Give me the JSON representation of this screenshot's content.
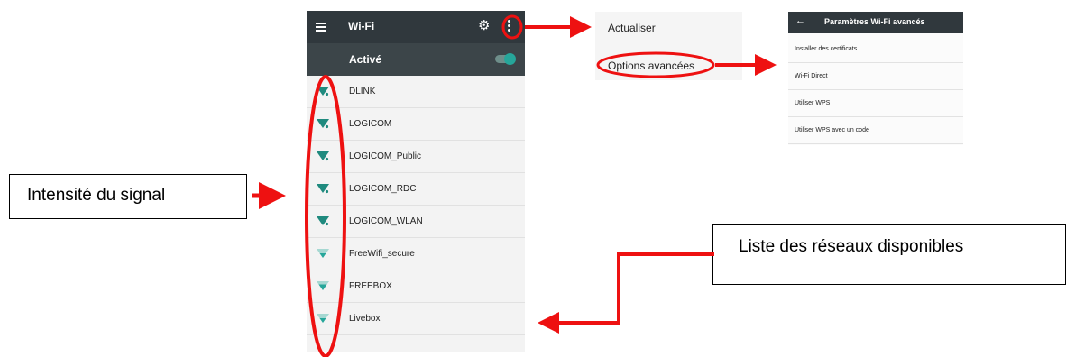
{
  "wifi_screen": {
    "title": "Wi-Fi",
    "status_label": "Activé",
    "icons": [
      "menu-icon",
      "gear-icon",
      "more-vert-icon",
      "wifi-signal-icon"
    ],
    "toggle_on": true,
    "networks": [
      {
        "name": "DLINK",
        "signal": 4
      },
      {
        "name": "LOGICOM",
        "signal": 4
      },
      {
        "name": "LOGICOM_Public",
        "signal": 4
      },
      {
        "name": "LOGICOM_RDC",
        "signal": 4
      },
      {
        "name": "LOGICOM_WLAN",
        "signal": 4
      },
      {
        "name": "FreeWifi_secure",
        "signal": 2
      },
      {
        "name": "FREEBOX",
        "signal": 2
      },
      {
        "name": "Livebox",
        "signal": 2
      }
    ]
  },
  "overflow_menu": {
    "items": [
      "Actualiser",
      "Options avancées"
    ]
  },
  "advanced_screen": {
    "title": "Paramètres Wi-Fi avancés",
    "back_icon": "arrow-back-icon",
    "items": [
      "Installer des certificats",
      "Wi-Fi Direct",
      "Utiliser WPS",
      "Utiliser WPS avec un code"
    ]
  },
  "annotations": {
    "signal_label": "Intensité du signal",
    "list_label": "Liste des réseaux disponibles"
  },
  "colors": {
    "toolbar": "#30383d",
    "accent_teal": "#26a69a",
    "annotation_red": "#ee1111"
  }
}
